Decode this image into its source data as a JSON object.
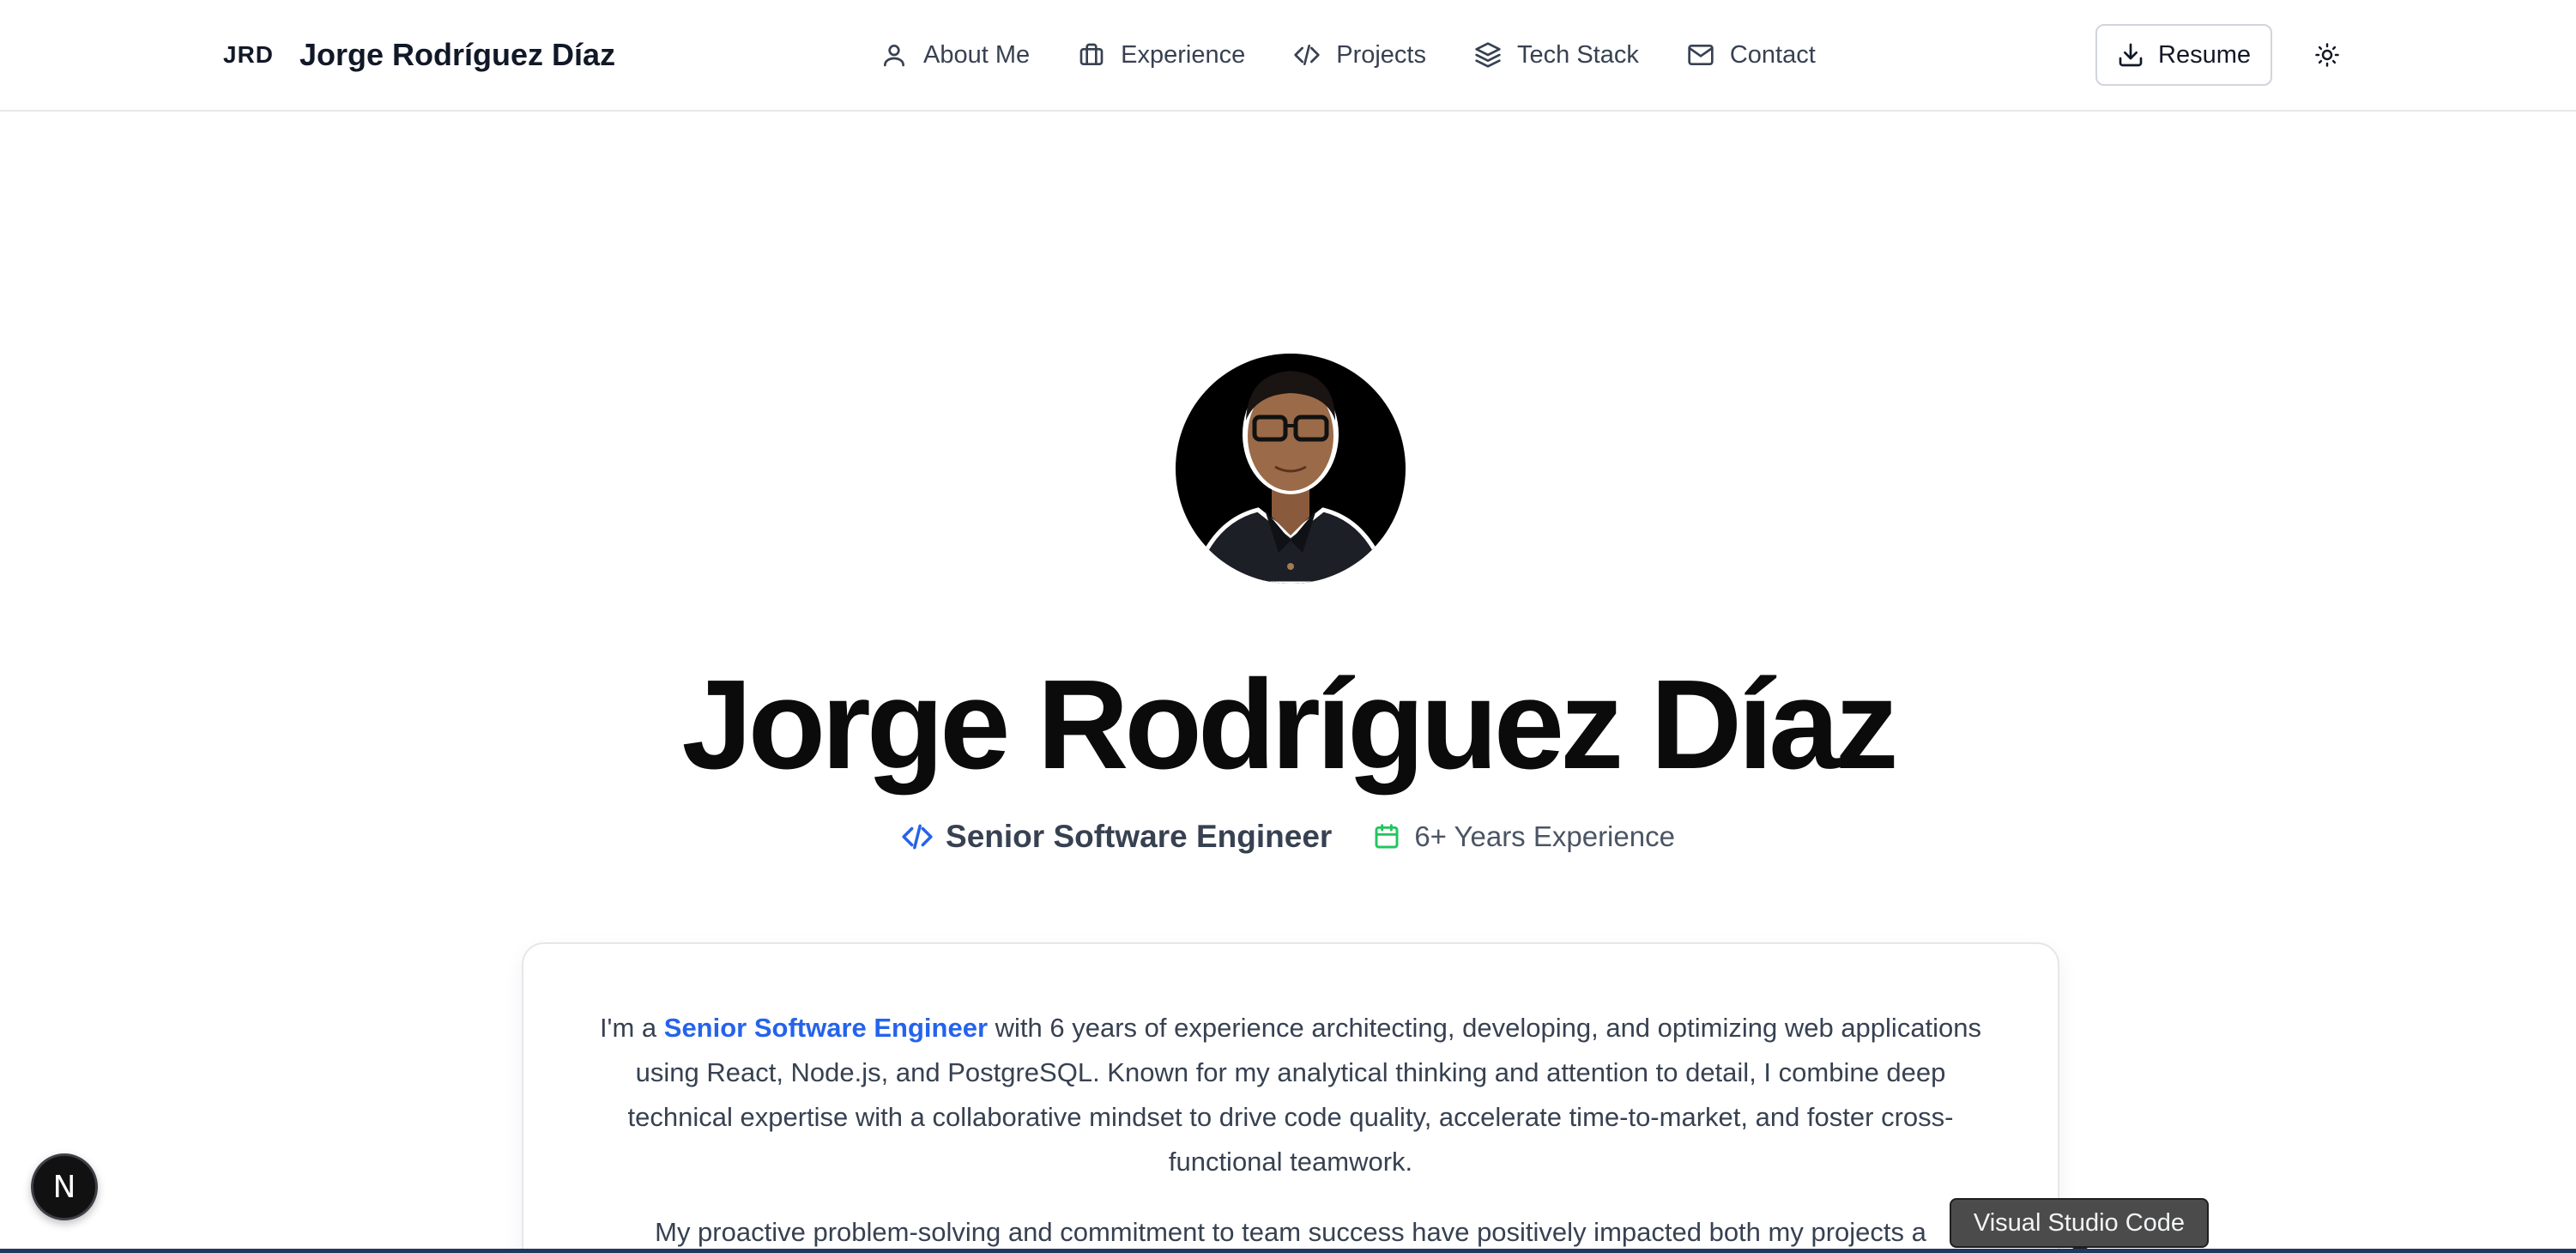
{
  "header": {
    "brand_mark": "JRD",
    "brand_name": "Jorge Rodríguez Díaz",
    "nav": [
      {
        "label": "About Me",
        "icon": "user-icon"
      },
      {
        "label": "Experience",
        "icon": "briefcase-icon"
      },
      {
        "label": "Projects",
        "icon": "code-icon"
      },
      {
        "label": "Tech Stack",
        "icon": "layers-icon"
      },
      {
        "label": "Contact",
        "icon": "mail-icon"
      }
    ],
    "resume_label": "Resume",
    "resume_icon": "download-icon",
    "theme_icon": "sun-icon"
  },
  "hero": {
    "avatar_icon": "profile-photo",
    "name": "Jorge Rodríguez Díaz",
    "role": "Senior Software Engineer",
    "role_icon": "code-icon",
    "years": "6+ Years Experience",
    "years_icon": "calendar-icon"
  },
  "about": {
    "p1_prefix": "I'm a ",
    "p1_highlight": "Senior Software Engineer",
    "p1_rest": " with 6 years of experience architecting, developing, and optimizing web applications using React, Node.js, and PostgreSQL. Known for my analytical thinking and attention to detail, I combine deep technical expertise with a collaborative mindset to drive code quality, accelerate time-to-market, and foster cross-functional teamwork.",
    "p2": "My proactive problem-solving and commitment to team success have positively impacted both my projects a"
  },
  "overlays": {
    "next_badge": "N",
    "tooltip": "Visual Studio Code"
  },
  "colors": {
    "accent": "#2563eb",
    "calendar": "#22c55e",
    "text": "#111827",
    "muted": "#374151"
  }
}
